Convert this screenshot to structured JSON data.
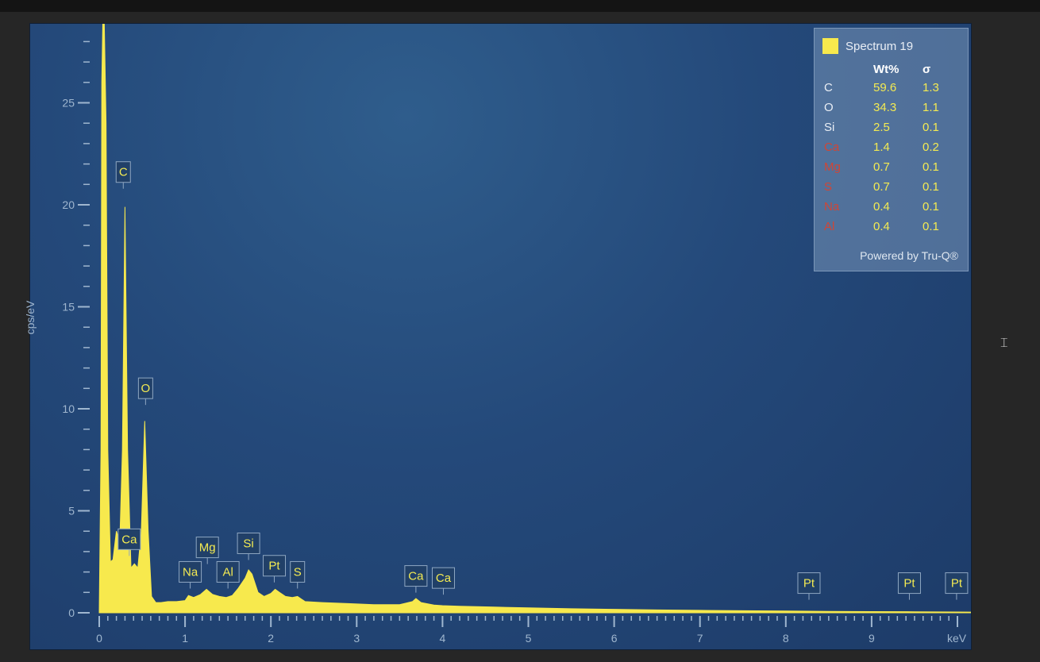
{
  "chart_data": {
    "type": "line",
    "title": "",
    "xlabel": "keV",
    "ylabel": "cps/eV",
    "xlim": [
      0,
      10.5
    ],
    "ylim": [
      0,
      29
    ],
    "x_ticks": [
      "0",
      "1",
      "2",
      "3",
      "4",
      "5",
      "6",
      "7",
      "8",
      "9"
    ],
    "y_ticks": [
      "0",
      "5",
      "10",
      "15",
      "20",
      "25"
    ],
    "grid": false,
    "legend_position": "top-right",
    "series": [
      {
        "name": "Spectrum 19",
        "color": "#f7e94d",
        "x": [
          0.0,
          0.02,
          0.03,
          0.05,
          0.08,
          0.1,
          0.13,
          0.16,
          0.2,
          0.24,
          0.27,
          0.3,
          0.33,
          0.37,
          0.41,
          0.45,
          0.49,
          0.53,
          0.57,
          0.61,
          0.66,
          0.72,
          0.8,
          0.9,
          1.0,
          1.04,
          1.1,
          1.18,
          1.25,
          1.32,
          1.4,
          1.48,
          1.55,
          1.62,
          1.7,
          1.74,
          1.78,
          1.85,
          1.92,
          2.0,
          2.05,
          2.1,
          2.17,
          2.25,
          2.31,
          2.4,
          2.6,
          2.9,
          3.2,
          3.5,
          3.65,
          3.69,
          3.75,
          3.9,
          4.0,
          4.2,
          4.6,
          5.0,
          5.5,
          6.0,
          6.5,
          7.0,
          7.5,
          8.0,
          8.5,
          9.0,
          9.5,
          10.0,
          10.4
        ],
        "y": [
          0,
          8,
          26,
          31,
          24,
          8,
          2.5,
          2.6,
          4.0,
          3.5,
          8,
          19.9,
          8,
          2.2,
          2.4,
          2.2,
          4,
          9.4,
          4,
          0.8,
          0.5,
          0.5,
          0.55,
          0.55,
          0.6,
          0.85,
          0.75,
          0.9,
          1.15,
          0.9,
          0.8,
          0.75,
          0.85,
          1.2,
          1.7,
          2.1,
          1.9,
          1.0,
          0.8,
          0.95,
          1.15,
          1.0,
          0.8,
          0.75,
          0.8,
          0.55,
          0.5,
          0.45,
          0.4,
          0.4,
          0.55,
          0.7,
          0.5,
          0.38,
          0.35,
          0.32,
          0.28,
          0.24,
          0.2,
          0.17,
          0.14,
          0.12,
          0.1,
          0.09,
          0.07,
          0.06,
          0.05,
          0.04,
          0.03
        ]
      }
    ],
    "peak_labels": [
      {
        "text": "C",
        "x": 0.28,
        "y": 21.1
      },
      {
        "text": "O",
        "x": 0.54,
        "y": 10.5
      },
      {
        "text": "Ca",
        "x": 0.35,
        "y": 3.1
      },
      {
        "text": "Na",
        "x": 1.06,
        "y": 1.5
      },
      {
        "text": "Mg",
        "x": 1.26,
        "y": 2.7
      },
      {
        "text": "Al",
        "x": 1.5,
        "y": 1.5
      },
      {
        "text": "Si",
        "x": 1.74,
        "y": 2.9
      },
      {
        "text": "Pt",
        "x": 2.04,
        "y": 1.8
      },
      {
        "text": "S",
        "x": 2.31,
        "y": 1.5
      },
      {
        "text": "Ca",
        "x": 3.69,
        "y": 1.3
      },
      {
        "text": "Ca",
        "x": 4.01,
        "y": 1.2
      },
      {
        "text": "Pt",
        "x": 8.27,
        "y": 0.95
      },
      {
        "text": "Pt",
        "x": 9.44,
        "y": 0.95
      },
      {
        "text": "Pt",
        "x": 9.99,
        "y": 0.95
      }
    ]
  },
  "legend": {
    "spectrum_name": "Spectrum 19",
    "swatch_color": "#f7e94d",
    "col_wt": "Wt%",
    "col_sigma": "σ",
    "rows": [
      {
        "el": "C",
        "wt": "59.6",
        "sigma": "1.3",
        "flag": false
      },
      {
        "el": "O",
        "wt": "34.3",
        "sigma": "1.1",
        "flag": false
      },
      {
        "el": "Si",
        "wt": "2.5",
        "sigma": "0.1",
        "flag": false
      },
      {
        "el": "Ca",
        "wt": "1.4",
        "sigma": "0.2",
        "flag": true
      },
      {
        "el": "Mg",
        "wt": "0.7",
        "sigma": "0.1",
        "flag": true
      },
      {
        "el": "S",
        "wt": "0.7",
        "sigma": "0.1",
        "flag": true
      },
      {
        "el": "Na",
        "wt": "0.4",
        "sigma": "0.1",
        "flag": true
      },
      {
        "el": "Al",
        "wt": "0.4",
        "sigma": "0.1",
        "flag": true
      }
    ],
    "powered_by": "Powered by Tru-Q®"
  },
  "colors": {
    "flagged_element": "#d04636",
    "label_text": "#f3ea52",
    "axis_text": "#9fb6cf"
  },
  "cursor_icon": "text-cursor-icon"
}
